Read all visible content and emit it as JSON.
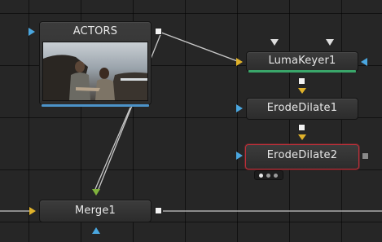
{
  "flow": {
    "nodes": {
      "actors": {
        "label": "ACTORS"
      },
      "lumakeyer": {
        "label": "LumaKeyer1"
      },
      "erode1": {
        "label": "ErodeDilate1"
      },
      "erode2": {
        "label": "ErodeDilate2"
      },
      "merge": {
        "label": "Merge1"
      }
    }
  },
  "colors": {
    "canvas_bg": "#262626",
    "node_bg": "#333333",
    "wire": "#bdbdbd",
    "input_main": "#e0b22a",
    "input_mask": "#4aa7e0",
    "input_background": "#7fb23c",
    "keyer_bar": "#3aa66a",
    "actors_bar": "#4c93c9",
    "selected_border": "#c0303a"
  },
  "icons": {
    "output": "white-square-icon",
    "main_input": "yellow-triangle-icon",
    "mask_input": "blue-triangle-icon",
    "background_input": "green-triangle-icon"
  }
}
